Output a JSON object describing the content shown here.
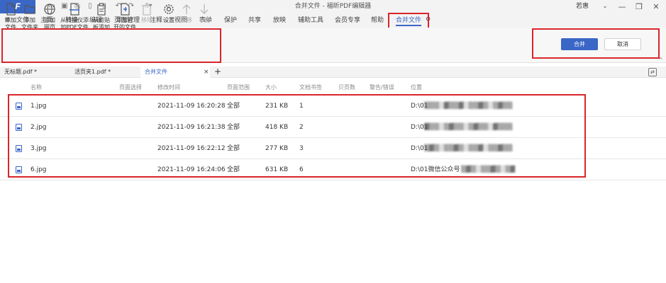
{
  "app": {
    "logo_letter": "F",
    "window_title": "合并文件 - 福昕PDF编辑器",
    "user_name": "若惠"
  },
  "menu": {
    "items": [
      "文件",
      "主页",
      "转换",
      "编辑",
      "页面管理",
      "注释",
      "视图",
      "表单",
      "保护",
      "共享",
      "放映",
      "辅助工具",
      "会员专享",
      "帮助",
      "合并文件"
    ],
    "active": "合并文件"
  },
  "toolbar": {
    "tools": [
      {
        "label": "添加\n文件",
        "icon": "add-file-icon"
      },
      {
        "label": "添加\n文件夹",
        "icon": "add-folder-icon"
      },
      {
        "label": "添加\n网页",
        "icon": "globe-icon"
      },
      {
        "label": "从扫描仪添\n加PDF文件",
        "icon": "scanner-icon"
      },
      {
        "label": "从剪贴\n板添加",
        "icon": "clipboard-icon"
      },
      {
        "label": "添加打\n开的文件",
        "icon": "open-file-icon"
      },
      {
        "label": "移除",
        "icon": "remove-icon"
      },
      {
        "label": "设置",
        "icon": "gear-icon"
      },
      {
        "label": "上移",
        "icon": "move-up-icon"
      },
      {
        "label": "下移",
        "icon": "move-down-icon"
      }
    ],
    "merge_label": "合并",
    "cancel_label": "取消"
  },
  "tabs": [
    {
      "label": "无标题.pdf *"
    },
    {
      "label": "活页夹1.pdf *"
    },
    {
      "label": "合并文件"
    }
  ],
  "table": {
    "headers": [
      "名称",
      "页面选择",
      "修改时间",
      "页面范围",
      "大小",
      "文档书签",
      "贝页数",
      "警告/错误",
      "位置"
    ],
    "rows": [
      {
        "name": "1.jpg",
        "modified": "2021-11-09 16:20:28",
        "range": "全部",
        "size": "231 KB",
        "bookmark": "1",
        "location": "D:\\01"
      },
      {
        "name": "2.jpg",
        "modified": "2021-11-09 16:21:38",
        "range": "全部",
        "size": "418 KB",
        "bookmark": "2",
        "location": "D:\\01"
      },
      {
        "name": "3.jpg",
        "modified": "2021-11-09 16:22:12",
        "range": "全部",
        "size": "277 KB",
        "bookmark": "3",
        "location": "D:\\01"
      },
      {
        "name": "6.jpg",
        "modified": "2021-11-09 16:24:06",
        "range": "全部",
        "size": "631 KB",
        "bookmark": "6",
        "location": "D:\\01微信公众号"
      }
    ]
  },
  "colors": {
    "accent": "#3a66c6",
    "highlight_box": "#d9252b"
  }
}
